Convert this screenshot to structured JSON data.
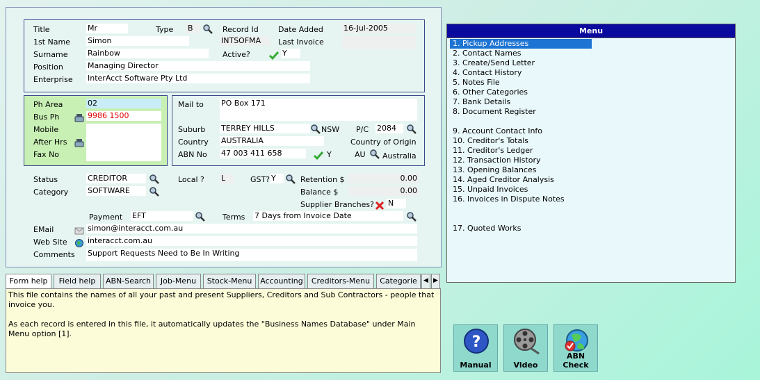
{
  "form": {
    "title_label": "Title",
    "title_value": "Mr",
    "type_label": "Type",
    "type_value": "B",
    "record_id_label": "Record Id",
    "record_id_value": "INTSOFMA",
    "date_added_label": "Date Added",
    "date_added_value": "16-Jul-2005",
    "first_name_label": "1st Name",
    "first_name_value": "Simon",
    "last_invoice_label": "Last Invoice",
    "last_invoice_value": "",
    "surname_label": "Surname",
    "surname_value": "Rainbow",
    "active_label": "Active?",
    "active_value": "Y",
    "position_label": "Position",
    "position_value": "Managing Director",
    "enterprise_label": "Enterprise",
    "enterprise_value": "InterAcct Software Pty Ltd",
    "ph_area_label": "Ph Area",
    "ph_area_value": "02",
    "bus_ph_label": "Bus Ph",
    "bus_ph_value": "9986 1500",
    "mobile_label": "Mobile",
    "mobile_value": "",
    "after_hrs_label": "After Hrs",
    "after_hrs_value": "",
    "fax_label": "Fax No",
    "fax_value": "",
    "mail_to_label": "Mail to",
    "mail_to_value": "PO Box 171",
    "suburb_label": "Suburb",
    "suburb_value": "TERREY HILLS",
    "state_value": "NSW",
    "pc_label": "P/C",
    "pc_value": "2084",
    "country_label": "Country",
    "country_value": "AUSTRALIA",
    "country_origin_label": "Country of Origin",
    "abn_label": "ABN No",
    "abn_value": "47 003 411 658",
    "abn_flag": "Y",
    "origin_code": "AU",
    "origin_name": "Australia",
    "status_label": "Status",
    "status_value": "CREDITOR",
    "local_label": "Local ?",
    "local_value": "L",
    "gst_label": "GST?",
    "gst_value": "Y",
    "retention_label": "Retention $",
    "retention_value": "0.00",
    "category_label": "Category",
    "category_value": "SOFTWARE",
    "balance_label": "Balance  $",
    "balance_value": "0.00",
    "supplier_branches_label": "Supplier Branches?",
    "supplier_branches_value": "N",
    "payment_label": "Payment",
    "payment_value": "EFT",
    "terms_label": "Terms",
    "terms_value": "7 Days from Invoice Date",
    "email_label": "EMail",
    "email_value": "simon@interacct.com.au",
    "website_label": "Web Site",
    "website_value": "interacct.com.au",
    "comments_label": "Comments",
    "comments_value": "Support Requests Need to Be In Writing"
  },
  "menu": {
    "title": "Menu",
    "items": [
      "1. Pickup Addresses",
      "2. Contact Names",
      "3. Create/Send Letter",
      "4. Contact History",
      "5. Notes File",
      "6. Other Categories",
      "7. Bank Details",
      "8. Document Register",
      "9. Account Contact Info",
      "10. Creditor's Totals",
      "11. Creditor's Ledger",
      "12. Transaction History",
      "13. Opening Balances",
      "14. Aged Creditor Analysis",
      "15. Unpaid Invoices",
      "16. Invoices in Dispute Notes",
      "17. Quoted Works"
    ]
  },
  "tabs": [
    "Form help",
    "Field help",
    "ABN-Search",
    "Job-Menu",
    "Stock-Menu",
    "Accounting",
    "Creditors-Menu",
    "Categorie"
  ],
  "help": {
    "para1": "This file contains the names of all your past and present Suppliers, Creditors and Sub Contractors - people that invoice you.",
    "para2": "As each record is entered in this file, it automatically updates the \"Business Names Database\" under Main Menu option [1]."
  },
  "buttons": {
    "manual": "Manual",
    "video": "Video",
    "abn_check": "ABN Check"
  },
  "colors": {
    "menu_title_bg": "#0a0a9e",
    "selected_item_bg": "#1e74d2",
    "phone_panel_bg": "#c8f0b4",
    "help_bg": "#fcfcd8",
    "button_bg": "#8ed8cc",
    "phone_red": "#e00000"
  },
  "icons": [
    "magnifier-icon",
    "checkmark-icon",
    "cross-icon",
    "phone-icon",
    "email-icon",
    "globe-icon",
    "help-icon",
    "film-reel-icon",
    "globe-check-icon"
  ]
}
